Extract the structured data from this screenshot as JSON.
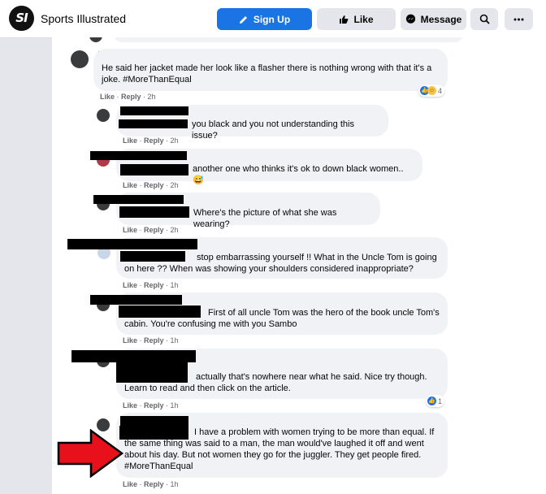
{
  "topbar": {
    "logo_text": "SI",
    "page_name": "Sports Illustrated",
    "sign_up_label": "Sign Up",
    "like_label": "Like",
    "message_label": "Message"
  },
  "comments": [
    {
      "text": "He said her jacket made her look like a flasher there is nothing wrong with that it's a joke. #MoreThanEqual",
      "like": "Like",
      "reply": "Reply",
      "time": "2h",
      "reaction_count": "4"
    },
    {
      "text": "you black and you not understanding this issue?",
      "like": "Like",
      "reply": "Reply",
      "time": "2h"
    },
    {
      "text": "another one who thinks it's ok to down black women..",
      "emoji": "😅",
      "like": "Like",
      "reply": "Reply",
      "time": "2h"
    },
    {
      "text": "Where's the picture of what she was wearing?",
      "like": "Like",
      "reply": "Reply",
      "time": "2h"
    },
    {
      "text": "stop embarrassing yourself !! What in the Uncle Tom is going on here ?? When was showing your shoulders considered inappropriate?",
      "like": "Like",
      "reply": "Reply",
      "time": "1h"
    },
    {
      "text": "First of all uncle Tom was the hero of the book uncle Tom's cabin. You're confusing me with you Sambo",
      "like": "Like",
      "reply": "Reply",
      "time": "1h"
    },
    {
      "text": "actually that's nowhere near what he said. Nice try though. Learn to read and then click on the article.",
      "like": "Like",
      "reply": "Reply",
      "time": "1h",
      "reaction_count": "1"
    },
    {
      "text": "I have a problem with women trying to be more than equal. If the same thing was said to a man, the man would've laughed it off and went about his day. But not women they go for the juggler. They get people fired. #MoreThanEqual",
      "like": "Like",
      "reply": "Reply",
      "time": "1h"
    }
  ],
  "colors": {
    "primary": "#1b74e4",
    "arrow": "#e8101a",
    "bubble": "#f0f2f5"
  },
  "icons": [
    "pencil-icon",
    "thumbs-up-icon",
    "messenger-icon",
    "search-icon",
    "more-icon",
    "red-arrow-icon"
  ]
}
